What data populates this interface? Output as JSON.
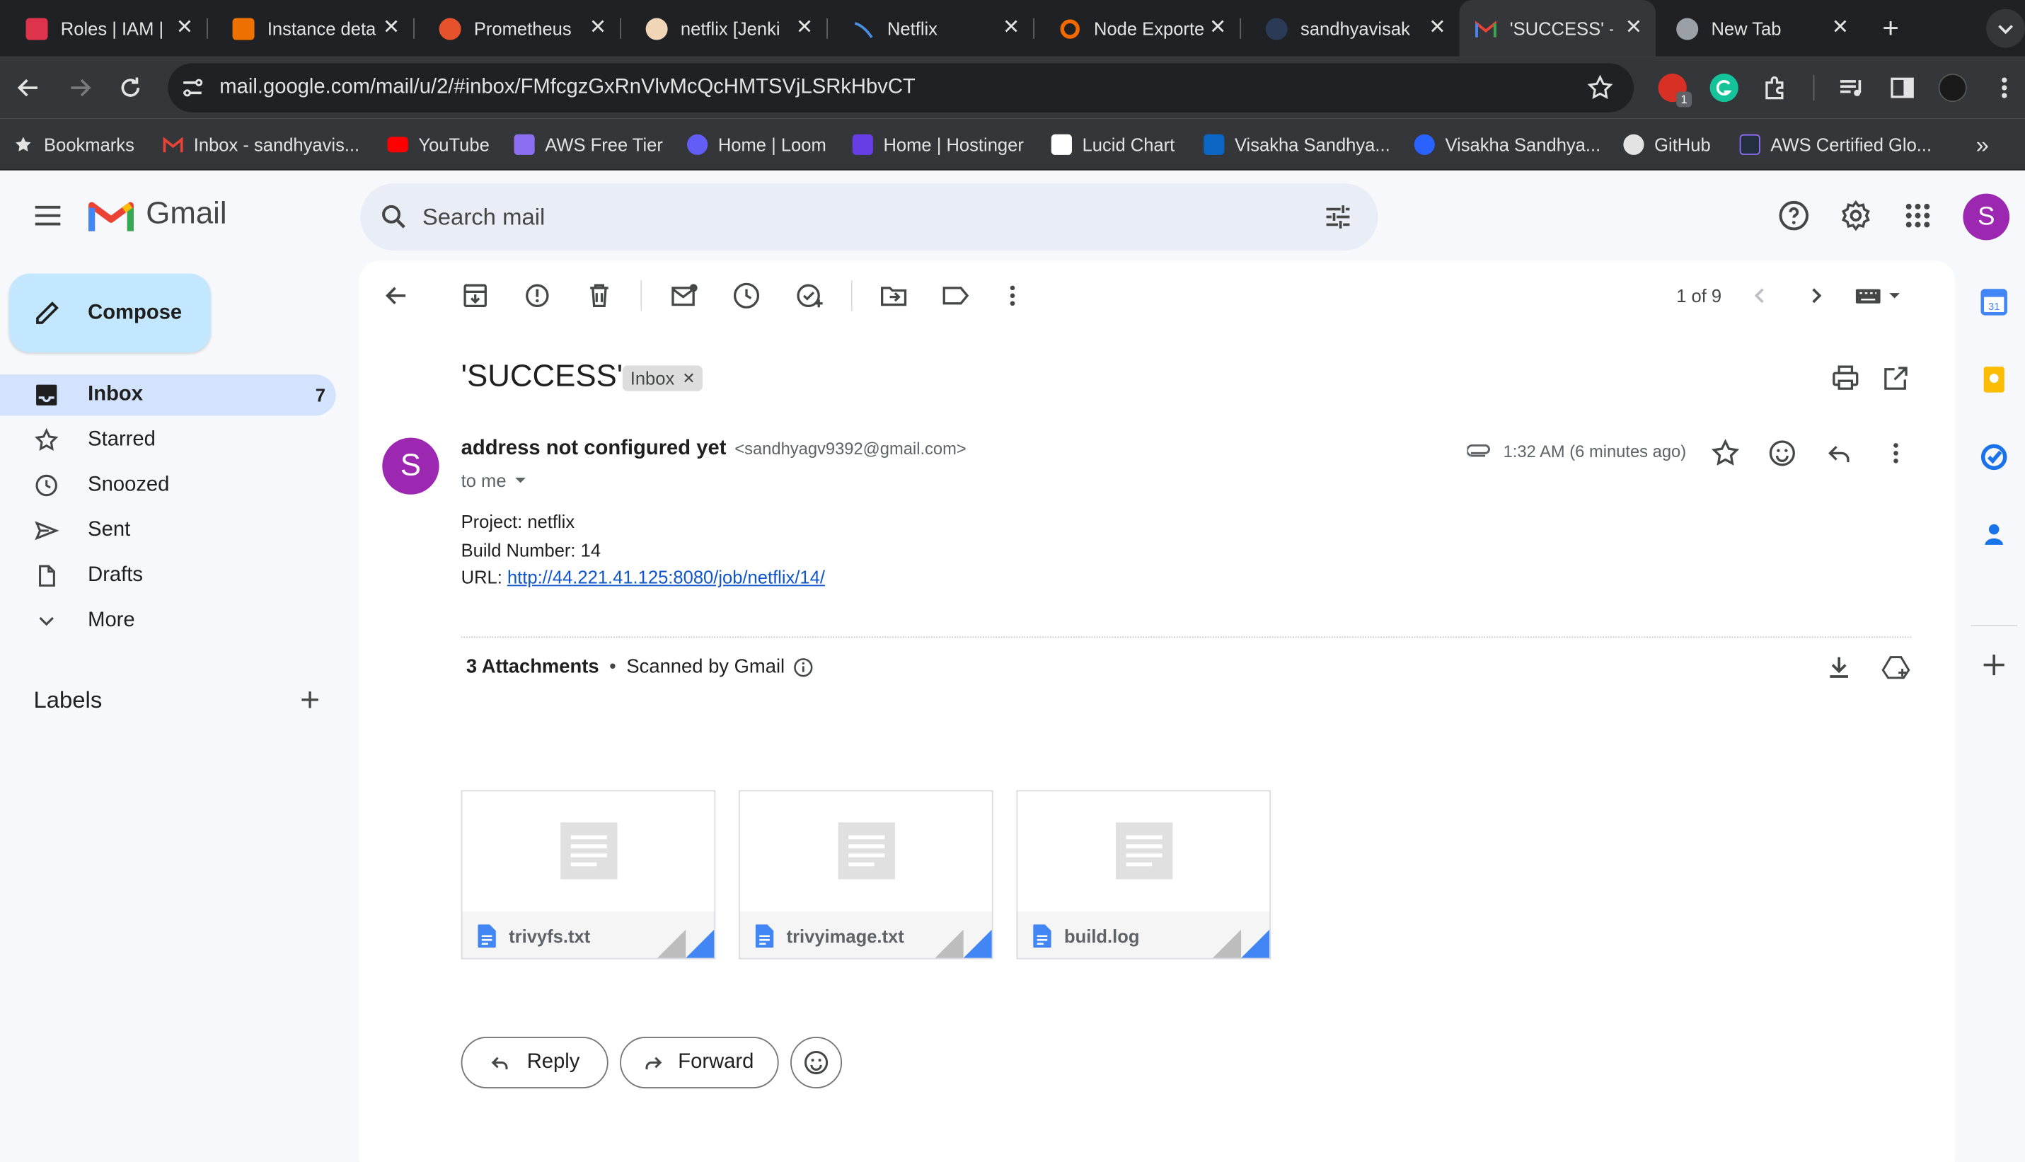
{
  "browser": {
    "tabs": [
      {
        "title": "Roles | IAM | ",
        "favicon": "aws-iam-icon",
        "color": "#dd344c"
      },
      {
        "title": "Instance deta",
        "favicon": "aws-ec2-icon",
        "color": "#ed7100"
      },
      {
        "title": "Prometheus",
        "favicon": "prometheus-icon",
        "color": "#e6522c"
      },
      {
        "title": "netflix [Jenki",
        "favicon": "jenkins-icon",
        "color": "#d33833"
      },
      {
        "title": "Netflix",
        "favicon": "netflix-icon",
        "color": "#4a90e2"
      },
      {
        "title": "Node Exporte",
        "favicon": "grafana-icon",
        "color": "#f46800"
      },
      {
        "title": "sandhyavisak",
        "favicon": "github-icon",
        "color": "#1f6feb"
      },
      {
        "title": "'SUCCESS' -",
        "favicon": "gmail-icon",
        "color": "#ea4335",
        "active": true
      },
      {
        "title": "New Tab",
        "favicon": "chrome-icon",
        "color": "#9aa0a6"
      }
    ],
    "url": "mail.google.com/mail/u/2/#inbox/FMfcgzGxRnVlvMcQcHMTSVjLSRkHbvCT",
    "extension_badge": "1",
    "bookmarks": [
      {
        "label": "Bookmarks",
        "icon": "star-icon"
      },
      {
        "label": "Inbox - sandhyavis...",
        "icon": "gmail-icon"
      },
      {
        "label": "YouTube",
        "icon": "youtube-icon"
      },
      {
        "label": "AWS Free Tier",
        "icon": "aws-icon"
      },
      {
        "label": "Home | Loom",
        "icon": "loom-icon"
      },
      {
        "label": "Home | Hostinger",
        "icon": "hostinger-icon"
      },
      {
        "label": "Lucid Chart",
        "icon": "lucid-icon"
      },
      {
        "label": "Visakha Sandhya...",
        "icon": "linkedin-icon"
      },
      {
        "label": "Visakha Sandhya...",
        "icon": "hashnode-icon"
      },
      {
        "label": "GitHub",
        "icon": "github-icon"
      },
      {
        "label": "AWS Certified Glo...",
        "icon": "aws-cert-icon"
      }
    ]
  },
  "gmail": {
    "brand": "Gmail",
    "search_placeholder": "Search mail",
    "avatar_letter": "S",
    "compose": "Compose",
    "nav": [
      {
        "label": "Inbox",
        "count": "7",
        "icon": "inbox-icon",
        "active": true
      },
      {
        "label": "Starred",
        "count": "",
        "icon": "star-icon"
      },
      {
        "label": "Snoozed",
        "count": "",
        "icon": "clock-icon"
      },
      {
        "label": "Sent",
        "count": "",
        "icon": "send-icon"
      },
      {
        "label": "Drafts",
        "count": "",
        "icon": "draft-icon"
      },
      {
        "label": "More",
        "count": "",
        "icon": "chevron-down-icon"
      }
    ],
    "labels_heading": "Labels",
    "pager": "1 of 9",
    "subject": "'SUCCESS'",
    "label_chip": "Inbox",
    "sender_name": "address not configured yet",
    "sender_email": "<sandhyagv9392@gmail.com>",
    "to": "to me",
    "time": "1:32 AM (6 minutes ago)",
    "body": {
      "project": "Project: netflix",
      "build": "Build Number: 14",
      "url_label": "URL: ",
      "url": "http://44.221.41.125:8080/job/netflix/14/"
    },
    "attachments_title": "3 Attachments",
    "scanned": "Scanned by Gmail",
    "attachments": [
      "trivyfs.txt",
      "trivyimage.txt",
      "build.log"
    ],
    "reply": "Reply",
    "forward": "Forward"
  },
  "colors": {
    "accent": "#0b57d0",
    "compose_bg": "#c2e7ff",
    "active_nav": "#d3e3fd",
    "avatar": "#9c27b0"
  }
}
